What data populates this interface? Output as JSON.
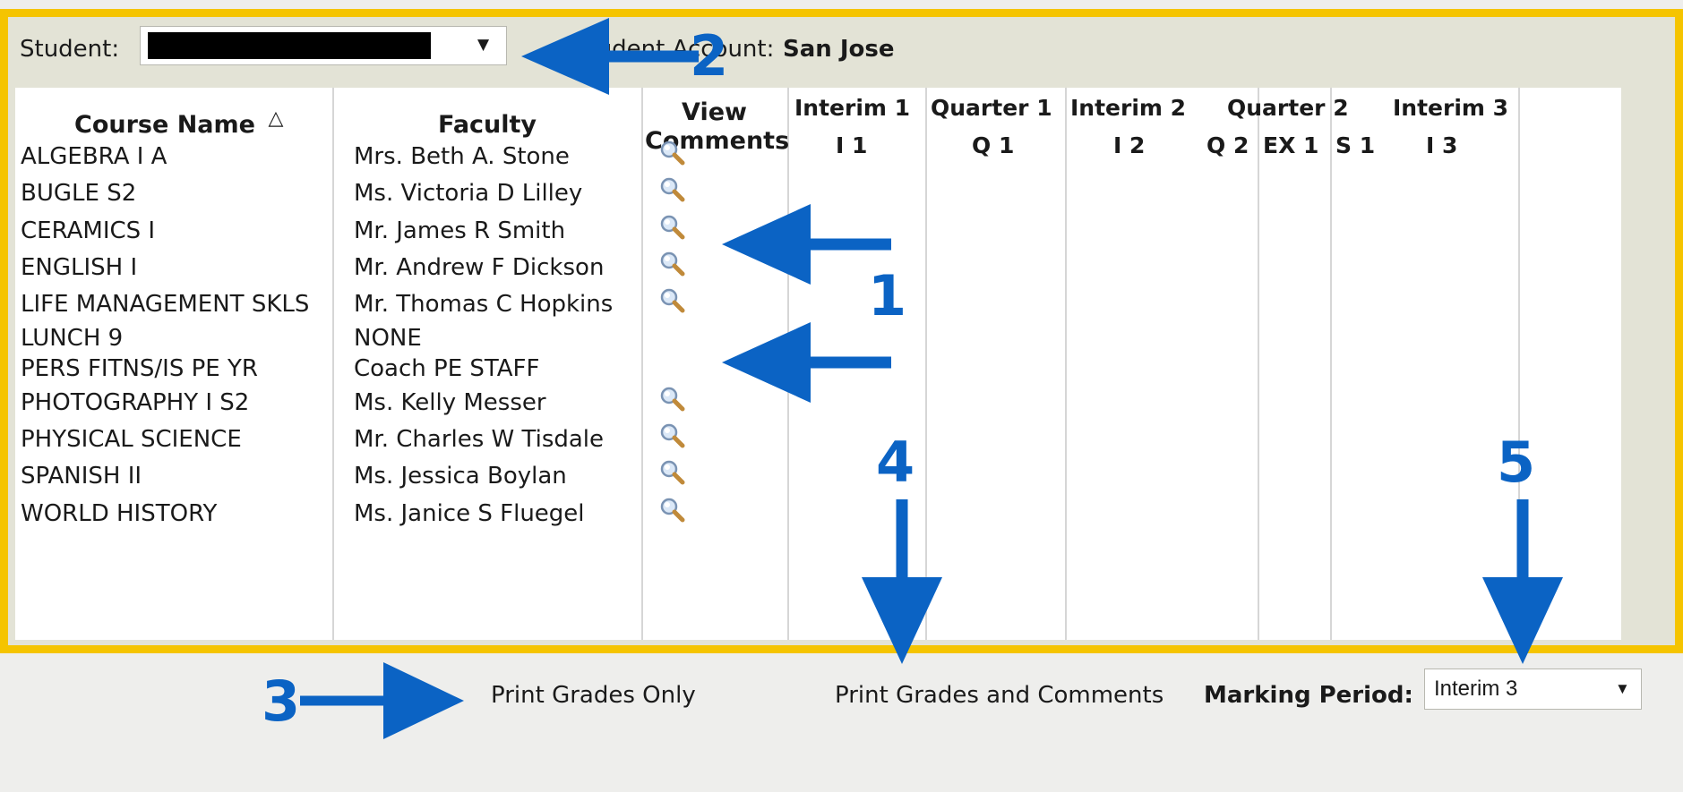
{
  "header": {
    "student_label": "Student:",
    "student_value": "",
    "account_prefix": "Student Account:",
    "account_value": "San Jose",
    "sort_icon": "sort-ascending-icon"
  },
  "columns": {
    "course_name": "Course Name",
    "faculty": "Faculty",
    "view": "View",
    "comments": "Comments",
    "interim1": "Interim 1",
    "quarter1": "Quarter 1",
    "interim2": "Interim 2",
    "quarter2": "Quarter 2",
    "interim3": "Interim 3",
    "sub": [
      "I 1",
      "Q 1",
      "I 2",
      "Q 2",
      "EX 1",
      "S 1",
      "I 3"
    ]
  },
  "courses": [
    {
      "name": "ALGEBRA I A",
      "faculty": "Mrs. Beth A. Stone",
      "comments": true
    },
    {
      "name": "BUGLE S2",
      "faculty": "Ms. Victoria D Lilley",
      "comments": true
    },
    {
      "name": "CERAMICS I",
      "faculty": "Mr. James R Smith",
      "comments": true
    },
    {
      "name": "ENGLISH I",
      "faculty": "Mr. Andrew F Dickson",
      "comments": true
    },
    {
      "name": "LIFE MANAGEMENT SKLS",
      "faculty": "Mr. Thomas C Hopkins",
      "comments": true
    },
    {
      "name": "LUNCH 9",
      "faculty": "NONE",
      "comments": false
    },
    {
      "name": "PERS FITNS/IS PE YR",
      "faculty": "Coach PE STAFF",
      "comments": false
    },
    {
      "name": "PHOTOGRAPHY I S2",
      "faculty": "Ms. Kelly Messer",
      "comments": true
    },
    {
      "name": "PHYSICAL SCIENCE",
      "faculty": "Mr. Charles W Tisdale",
      "comments": true
    },
    {
      "name": "SPANISH II",
      "faculty": "Ms. Jessica Boylan",
      "comments": true
    },
    {
      "name": "WORLD HISTORY",
      "faculty": "Ms. Janice S Fluegel",
      "comments": true
    }
  ],
  "footer": {
    "print_grades_only": "Print Grades Only",
    "print_grades_comments": "Print Grades and Comments",
    "marking_period_label": "Marking Period:",
    "marking_period_value": "Interim 3"
  },
  "annotations": [
    "1",
    "2",
    "3",
    "4",
    "5"
  ],
  "colors": {
    "accent_border": "#f5c400",
    "annotation_blue": "#0b63c4"
  }
}
